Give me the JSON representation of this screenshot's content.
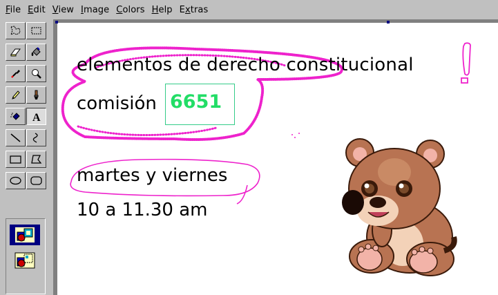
{
  "menu": [
    {
      "label": "File",
      "key": "F"
    },
    {
      "label": "Edit",
      "key": "E"
    },
    {
      "label": "View",
      "key": "V"
    },
    {
      "label": "Image",
      "key": "I"
    },
    {
      "label": "Colors",
      "key": "C"
    },
    {
      "label": "Help",
      "key": "H"
    },
    {
      "label": "Extras",
      "key": "x"
    }
  ],
  "canvas": {
    "line1": "elementos de derecho constitucional",
    "line2": "comisión",
    "code": "6651",
    "line3": "martes y viernes",
    "line4": "10 a 11.30 am",
    "exclaim": "!"
  },
  "colors": {
    "ink": "#000000",
    "highlight_green": "#22dd66",
    "marker_magenta": "#ee22cc",
    "ui_gray": "#c0c0c0"
  },
  "tools": [
    "free-select",
    "rect-select",
    "eraser",
    "fill",
    "color-picker",
    "magnifier",
    "pencil",
    "brush",
    "airbrush",
    "text",
    "line",
    "curve",
    "rectangle",
    "polygon",
    "ellipse",
    "rounded-rectangle"
  ],
  "active_tool": "text"
}
